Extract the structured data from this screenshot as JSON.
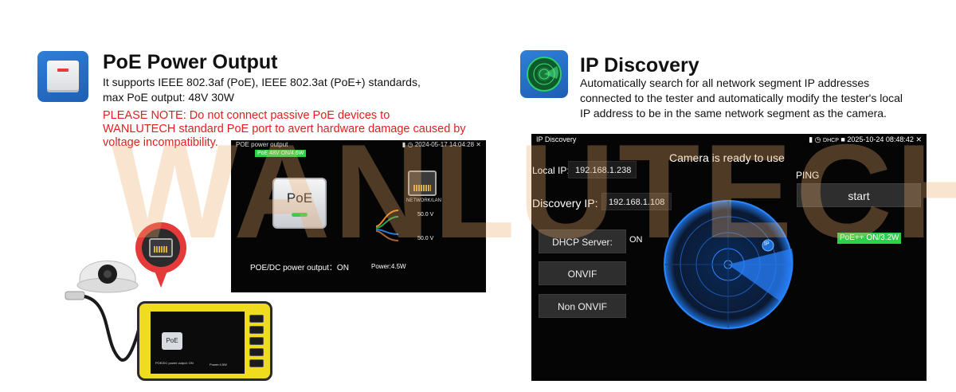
{
  "watermark": "WANLUTECH",
  "poe_feature": {
    "title": "PoE Power Output",
    "desc_line1": "It supports IEEE 802.3af (PoE), IEEE 802.3at (PoE+) standards,",
    "desc_line2": "max PoE output: 48V 30W",
    "note_line1": "PLEASE NOTE: Do not connect passive PoE devices to",
    "note_line2": "WANLUTECH standard PoE port to avert hardware damage caused by",
    "note_line3": "voltage incompatibility.",
    "icon": "poe-switch-icon",
    "screen": {
      "title": "POE power output",
      "status_right": "2024-05-17 14:04:28",
      "badge": "PoE 48V ON/4.6W",
      "button_label": "PoE",
      "port_label": "NETWORK/LAN",
      "voltage_1": "50.0 V",
      "voltage_2": "50.0 V",
      "output_label": "POE/DC power output：ON",
      "power_label": "Power:4.5W"
    },
    "illustration": {
      "device_screen_button": "PoE",
      "device_output_label": "POE/DC power output: ON",
      "device_power_label": "Power:4.5W"
    }
  },
  "ip_feature": {
    "title": "IP Discovery",
    "desc_line1": "Automatically search for all network segment IP addresses",
    "desc_line2": "connected to the tester and automatically modify the tester's local",
    "desc_line3": "IP address to be in the same network segment as the camera.",
    "icon": "radar-icon",
    "screen": {
      "title": "IP Discovery",
      "status_right": "2025-10-24 08:48:42",
      "dhcp_tag": "DHCP",
      "camera_status": "Camera is ready to use",
      "local_ip_label": "Local IP:",
      "local_ip_value": "192.168.1.238",
      "ping_label": "PING",
      "start_button": "start",
      "discovery_ip_label": "Discovery IP:",
      "discovery_ip_value": "192.168.1.108",
      "dhcp_label": "DHCP Server:",
      "dhcp_value": "ON",
      "onvif_button": "ONVIF",
      "non_onvif_button": "Non ONVIF",
      "poe_badge": "PoE++ ON/3.2W",
      "radar_ip_marker": "IP"
    }
  },
  "colors": {
    "note_red": "#e02020",
    "badge_green": "#2bd14a",
    "radar_blue": "#1e6fd8",
    "icon_blue": "#2f7fd8"
  }
}
